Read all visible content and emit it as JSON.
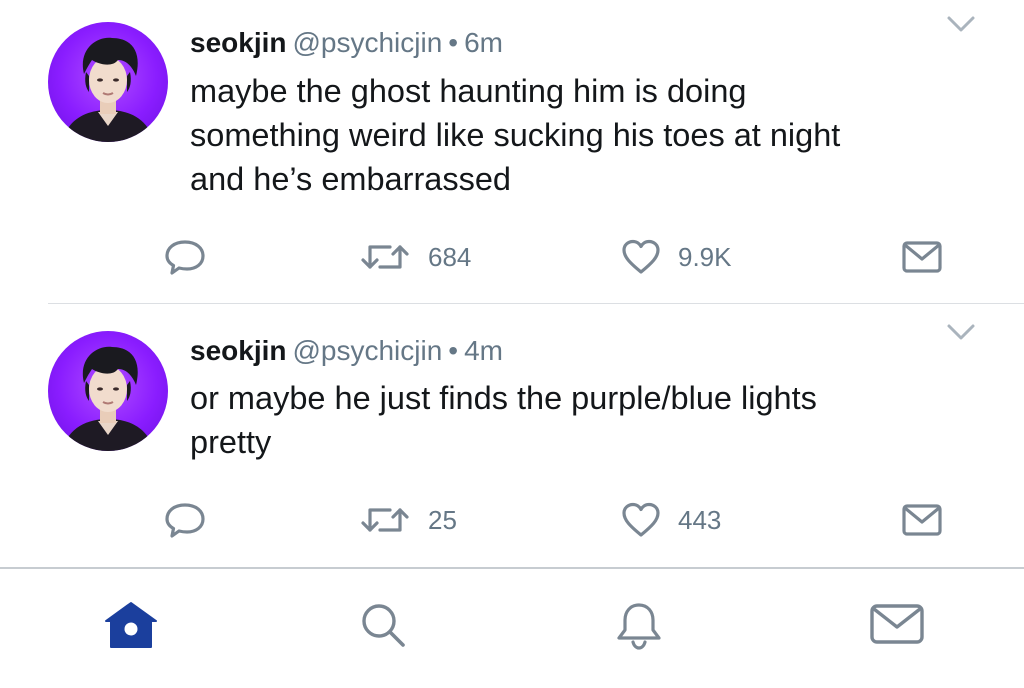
{
  "tweets": [
    {
      "name": "seokjin",
      "handle": "@psychicjin",
      "separator": "•",
      "time": "6m",
      "text_lines": [
        "maybe the ghost haunting him is doing",
        "something weird like sucking his toes at night",
        "and he’s embarrassed"
      ],
      "retweets": "684",
      "likes": "9.9K"
    },
    {
      "name": "seokjin",
      "handle": "@psychicjin",
      "separator": "•",
      "time": "4m",
      "text_lines": [
        "or maybe he just finds the purple/blue lights",
        "pretty"
      ],
      "retweets": "25",
      "likes": "443"
    }
  ],
  "icons": {
    "reply": "reply-icon",
    "retweet": "retweet-icon",
    "like": "heart-icon",
    "dm": "envelope-icon",
    "caret": "chevron-down-icon"
  },
  "tabbar": {
    "active": "home",
    "items": [
      "home-icon",
      "search-icon",
      "notifications-icon",
      "messages-icon"
    ]
  },
  "colors": {
    "accent": "#1b3f9d",
    "text": "#14171a",
    "muted": "#657786",
    "icon": "#7a8692",
    "avatar_bg": "#8a1dff"
  }
}
